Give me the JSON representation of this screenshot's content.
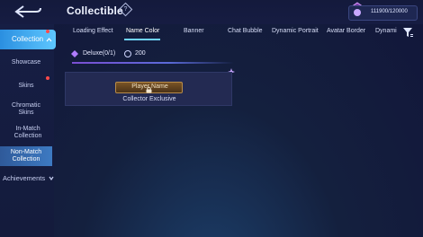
{
  "header": {
    "title": "Collectible",
    "info_icon": "diamond-question-icon",
    "points_value": "111900/120000",
    "points_icon": "gem-icon"
  },
  "sidebar": {
    "items": [
      {
        "label": "Collection",
        "active": true,
        "badge": true
      },
      {
        "label": "Showcase"
      },
      {
        "label": "Skins",
        "badge": true
      },
      {
        "label": "Chromatic Skins"
      },
      {
        "label": "In-Match Collection"
      },
      {
        "label": "Non-Match Collection",
        "active": true
      },
      {
        "label": "Achievements"
      }
    ]
  },
  "tabs": [
    "Loading Effect",
    "Name Color",
    "Banner",
    "Chat Bubble",
    "Dynamic Portrait",
    "Avatar Border",
    "Dynami"
  ],
  "active_tab": "Name Color",
  "section": {
    "label": "Deluxe(0/1)",
    "coin_value": "200"
  },
  "card": {
    "nameplate": "Player Name",
    "subtitle": "Collector Exclusive"
  },
  "colors": {
    "accent": "#5ec7ff",
    "background": "#14203e",
    "badge": "#ff4a4a"
  }
}
